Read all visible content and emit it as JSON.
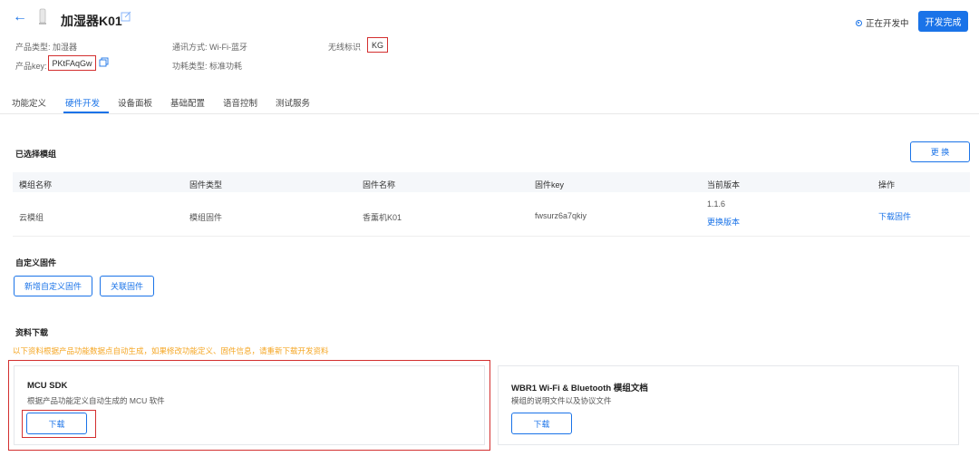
{
  "header": {
    "title": "加湿器K01",
    "status": "正在开发中",
    "primary_button": "开发完成"
  },
  "meta": {
    "product_type_label": "产品类型:",
    "product_type_value": "加湿器",
    "comm_label": "通讯方式:",
    "comm_value": "Wi-Fi-蓝牙",
    "wireless_label": "无线标识",
    "wireless_value": "KG",
    "product_key_label": "产品key:",
    "product_key_value": "PKtFAqGw",
    "power_label": "功耗类型:",
    "power_value": "标准功耗"
  },
  "tabs": [
    {
      "label": "功能定义"
    },
    {
      "label": "硬件开发"
    },
    {
      "label": "设备面板"
    },
    {
      "label": "基础配置"
    },
    {
      "label": "语音控制"
    },
    {
      "label": "测试服务"
    }
  ],
  "selected_module": {
    "title": "已选择模组",
    "change_button": "更 换",
    "columns": [
      "模组名称",
      "固件类型",
      "固件名称",
      "固件key",
      "当前版本",
      "操作"
    ],
    "row": {
      "module_name": "云模组",
      "firmware_type": "模组固件",
      "firmware_name": "香薰机K01",
      "firmware_key": "fwsurz6a7qkiy",
      "version": "1.1.6",
      "change_version": "更换版本",
      "action": "下载固件"
    }
  },
  "custom_firmware": {
    "title": "自定义固件",
    "add_button": "新增自定义固件",
    "link_button": "关联固件"
  },
  "downloads": {
    "title": "资料下载",
    "notice": "以下资料根据产品功能数据点自动生成，如果修改功能定义、固件信息，请重新下载开发资料",
    "cards": [
      {
        "title": "MCU SDK",
        "desc": "根据产品功能定义自动生成的 MCU 软件",
        "button": "下载"
      },
      {
        "title": "WBR1 Wi-Fi & Bluetooth 模组文档",
        "desc": "模组的说明文件以及协议文件",
        "button": "下载"
      }
    ]
  },
  "colors": {
    "accent": "#1a73e8",
    "warning": "#f5a623",
    "highlight": "#d32f2f"
  }
}
